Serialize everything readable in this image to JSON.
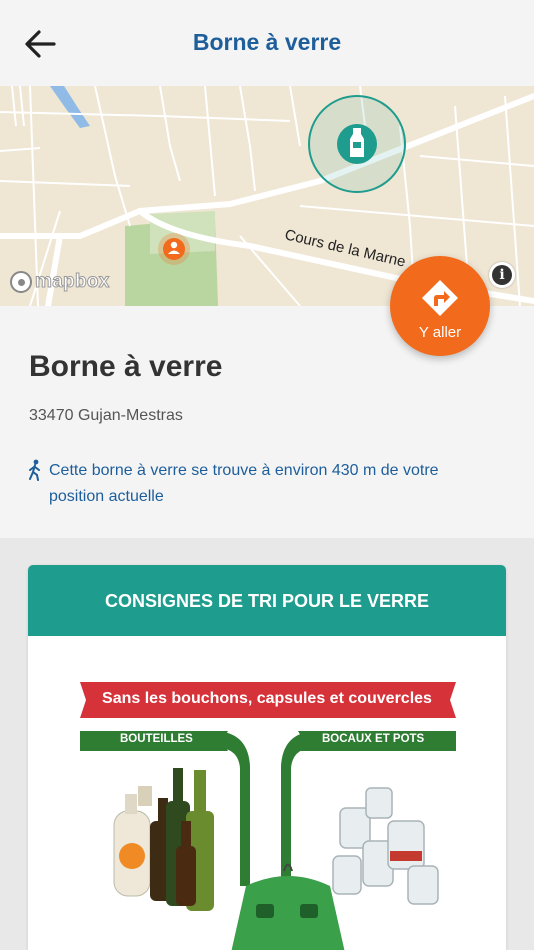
{
  "header": {
    "title": "Borne à verre"
  },
  "map": {
    "street_label": "Cours de la Marne",
    "attribution": "mapbox"
  },
  "action": {
    "go_label": "Y aller"
  },
  "details": {
    "name": "Borne à verre",
    "address": "33470 Gujan-Mestras",
    "distance_text": "Cette borne à verre se trouve à environ 430 m de votre position actuelle"
  },
  "card": {
    "title": "CONSIGNES DE TRI POUR LE VERRE",
    "banner": "Sans les bouchons, capsules et couvercles",
    "left_label": "BOUTEILLES",
    "right_label": "BOCAUX ET POTS"
  },
  "colors": {
    "accent": "#1d5e9b",
    "teal": "#1e9c8d",
    "orange": "#f26a1b",
    "banner_red": "#d6323a",
    "green": "#2e7d32"
  }
}
